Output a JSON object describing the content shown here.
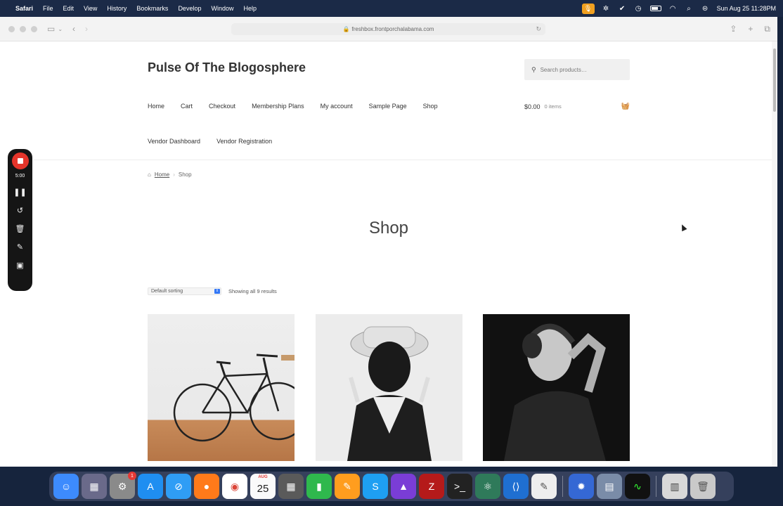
{
  "menubar": {
    "items": [
      "Safari",
      "File",
      "Edit",
      "View",
      "History",
      "Bookmarks",
      "Develop",
      "Window",
      "Help"
    ],
    "datetime": "Sun Aug 25  11:28PM"
  },
  "browser": {
    "url": "freshbox.frontporchalabama.com"
  },
  "site": {
    "title": "Pulse Of The Blogosphere",
    "search_placeholder": "Search products…",
    "nav": [
      "Home",
      "Cart",
      "Checkout",
      "Membership Plans",
      "My account",
      "Sample Page",
      "Shop"
    ],
    "nav2": [
      "Vendor Dashboard",
      "Vendor Registration"
    ],
    "cart_total": "$0.00",
    "cart_count": "0 items"
  },
  "breadcrumb": {
    "home": "Home",
    "current": "Shop"
  },
  "shop": {
    "title": "Shop",
    "sort_value": "Default sorting",
    "results": "Showing all 9 results"
  },
  "recorder": {
    "time": "5:00"
  },
  "dock": {
    "calendar_month": "AUG",
    "calendar_day": "25",
    "settings_badge": "1"
  }
}
